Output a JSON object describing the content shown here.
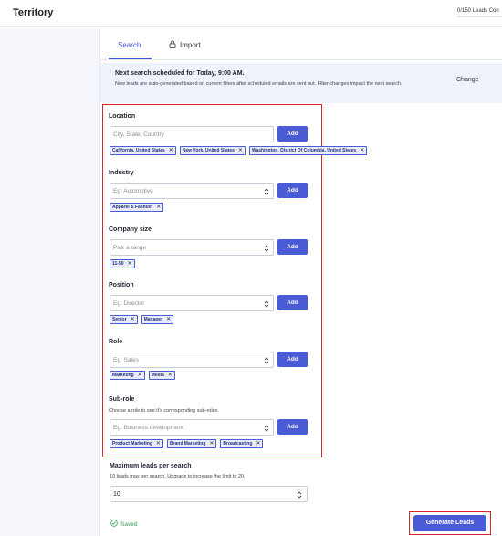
{
  "header": {
    "title": "Territory",
    "leads_count": "0/150 Leads Con",
    "leads_progress": 0
  },
  "tabs": [
    {
      "label": "Search",
      "active": true
    },
    {
      "label": "Import",
      "icon": "lock-icon",
      "active": false
    }
  ],
  "banner": {
    "title": "Next search scheduled for Today, 9:00 AM.",
    "text": "New leads are auto-generated based on current filters after scheduled emails are sent out. Filter changes impact the next search.",
    "change_label": "Change"
  },
  "filters": {
    "location": {
      "label": "Location",
      "placeholder": "City, State, Country",
      "add_label": "Add",
      "chips": [
        "California, United States",
        "New York, United States",
        "Washington, District Of Columbia, United States"
      ]
    },
    "industry": {
      "label": "Industry",
      "placeholder": "Eg: Automotive",
      "add_label": "Add",
      "chips": [
        "Apparel & Fashion"
      ]
    },
    "company_size": {
      "label": "Company size",
      "placeholder": "Pick a range",
      "add_label": "Add",
      "chips": [
        "11-50"
      ]
    },
    "position": {
      "label": "Position",
      "placeholder": "Eg: Director",
      "add_label": "Add",
      "chips": [
        "Senior",
        "Manager"
      ]
    },
    "role": {
      "label": "Role",
      "placeholder": "Eg: Sales",
      "add_label": "Add",
      "chips": [
        "Marketing",
        "Media"
      ]
    },
    "sub_role": {
      "label": "Sub-role",
      "help": "Choose a role to see it's corresponding sub-roles.",
      "placeholder": "Eg: Business development",
      "add_label": "Add",
      "chips": [
        "Product Marketing",
        "Brand Marketing",
        "Broadcasting"
      ]
    }
  },
  "max_leads": {
    "label": "Maximum leads per search",
    "help": "10 leads max per search. Upgrade to increase the limit to 20.",
    "value": "10"
  },
  "footer": {
    "saved_label": "Saved",
    "generate_label": "Generate Leads"
  },
  "colors": {
    "accent": "#4a5bd6",
    "highlight": "#d6262b",
    "saved": "#2f9e5a"
  }
}
